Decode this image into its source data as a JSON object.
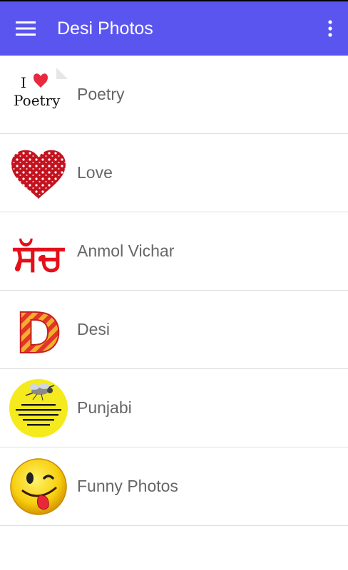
{
  "app": {
    "title": "Desi Photos",
    "menu_icon": "hamburger-menu-icon",
    "overflow_icon": "overflow-dots-icon",
    "accent_color": "#5b55ef"
  },
  "list": {
    "items": [
      {
        "label": "Poetry",
        "icon": "i-love-poetry-icon",
        "icon_text": [
          "I",
          "Poetry"
        ]
      },
      {
        "label": "Love",
        "icon": "heart-of-hearts-icon"
      },
      {
        "label": "Anmol Vichar",
        "icon": "punjabi-script-icon",
        "icon_text": "ਸੱਚ"
      },
      {
        "label": "Desi",
        "icon": "letter-d-logo-icon",
        "icon_text": "D"
      },
      {
        "label": "Punjabi",
        "icon": "punjabi-mosquito-meme-icon"
      },
      {
        "label": "Funny Photos",
        "icon": "tongue-out-smiley-icon"
      }
    ]
  }
}
